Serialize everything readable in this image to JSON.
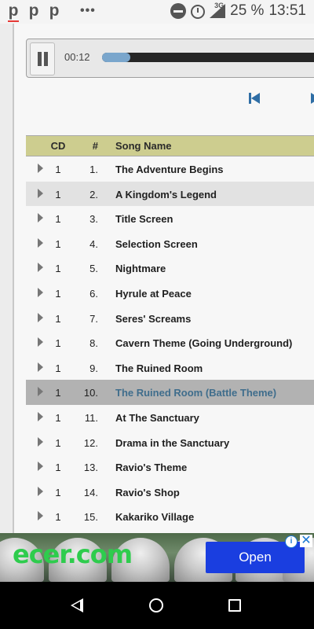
{
  "status_bar": {
    "app_icons": [
      "p",
      "p",
      "p"
    ],
    "overflow": "•••",
    "network": "3G",
    "battery": "25 %",
    "time": "13:51"
  },
  "player": {
    "elapsed": "00:12",
    "progress_fraction": 0.05
  },
  "table": {
    "headers": {
      "cd": "CD",
      "num": "#",
      "name": "Song Name"
    },
    "rows": [
      {
        "cd": "1",
        "num": "1.",
        "name": "The Adventure Begins"
      },
      {
        "cd": "1",
        "num": "2.",
        "name": "A Kingdom's Legend"
      },
      {
        "cd": "1",
        "num": "3.",
        "name": "Title Screen"
      },
      {
        "cd": "1",
        "num": "4.",
        "name": "Selection Screen"
      },
      {
        "cd": "1",
        "num": "5.",
        "name": "Nightmare"
      },
      {
        "cd": "1",
        "num": "6.",
        "name": "Hyrule at Peace"
      },
      {
        "cd": "1",
        "num": "7.",
        "name": "Seres' Screams"
      },
      {
        "cd": "1",
        "num": "8.",
        "name": "Cavern Theme (Going Underground)"
      },
      {
        "cd": "1",
        "num": "9.",
        "name": "The Ruined Room"
      },
      {
        "cd": "1",
        "num": "10.",
        "name": "The Ruined Room (Battle Theme)"
      },
      {
        "cd": "1",
        "num": "11.",
        "name": "At The Sanctuary"
      },
      {
        "cd": "1",
        "num": "12.",
        "name": "Drama in the Sanctuary"
      },
      {
        "cd": "1",
        "num": "13.",
        "name": "Ravio's Theme"
      },
      {
        "cd": "1",
        "num": "14.",
        "name": "Ravio's Shop"
      },
      {
        "cd": "1",
        "num": "15.",
        "name": "Kakariko Village"
      }
    ]
  },
  "ad": {
    "logo": "ecer.com",
    "cta": "Open",
    "info_icon": "i",
    "close_icon": "✕"
  },
  "colors": {
    "header_bg": "#cdcd8f",
    "playing_row_bg": "#b2b2b2",
    "playing_text": "#3f6d8c",
    "accent_blue": "#2f6ea5",
    "ad_button": "#1a3ee0"
  }
}
